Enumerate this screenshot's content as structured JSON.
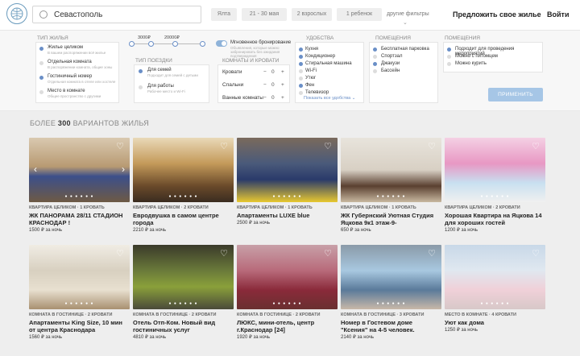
{
  "header": {
    "search_value": "Севастополь",
    "city": "Ялта",
    "dates": "21 - 30 мая",
    "guests": "2 взрослых",
    "children": "1 ребенок",
    "other_filters": "другие фильтры",
    "offer_link": "Предложить свое жилье",
    "login_link": "Войти"
  },
  "filters": {
    "housing_type": {
      "title": "ТИП ЖИЛЬЯ",
      "options": [
        {
          "label": "Жилье целиком",
          "sub": "В вашем распоряжении всё жилье"
        },
        {
          "label": "Отдельная комната",
          "sub": "В распоряжении комната, общие зоны"
        },
        {
          "label": "Гостиничный номер",
          "sub": "Отдельная комната в отеле или хостеле"
        },
        {
          "label": "Место в комнате",
          "sub": "Общее пространство с другими"
        }
      ]
    },
    "price": {
      "min": "3000₽",
      "max": "20000₽"
    },
    "trip_type": {
      "title": "ТИП ПОЕЗДКИ",
      "options": [
        {
          "label": "Для семей",
          "sub": "Подходит для семей с детьми"
        },
        {
          "label": "Для работы",
          "sub": "Рабочее место и Wi-Fi"
        }
      ]
    },
    "instant": {
      "label": "Мгновенное бронирование",
      "sub": "Объявления, которые можно забронировать без ожидания подтверждения"
    },
    "rooms": {
      "title": "КОМНАТЫ И КРОВАТИ",
      "rows": [
        {
          "label": "Кровати",
          "value": "0"
        },
        {
          "label": "Спальни",
          "value": "0"
        },
        {
          "label": "Ванные комнаты",
          "value": "0"
        }
      ]
    },
    "amenities": {
      "title": "УДОБСТВА",
      "options": [
        "Кухня",
        "Кондиционер",
        "Стиральная машина",
        "Wi-Fi",
        "Утюг",
        "Фен",
        "Телевизор"
      ],
      "show_all": "Показать все удобства"
    },
    "facilities": {
      "title": "ПОМЕЩЕНИЯ",
      "options": [
        "Бесплатная парковка",
        "Спортзал",
        "Джакузи",
        "Бассейн"
      ]
    },
    "rules": {
      "title": "ПОМЕЩЕНИЯ",
      "options": [
        "Подходит для проведения мероприятий",
        "Можно с питомцем",
        "Можно курить"
      ]
    },
    "apply": "ПРИМЕНИТЬ"
  },
  "results": {
    "count_prefix": "БОЛЕЕ ",
    "count": "300",
    "count_suffix": " ВАРИАНТОВ ЖИЛЬЯ",
    "listings": [
      {
        "type": "КВАРТИРА ЦЕЛИКОМ · 1 КРОВАТЬ",
        "title": "ЖК ПАНОРАМА 28/11 СТАДИОН КРАСНОДАР !",
        "price": "1500 ₽ за ночь"
      },
      {
        "type": "КВАРТИРА ЦЕЛИКОМ · 2 КРОВАТИ",
        "title": "Евродвушка в самом центре города",
        "price": "2210 ₽ за ночь"
      },
      {
        "type": "КВАРТИРА ЦЕЛИКОМ · 1 КРОВАТЬ",
        "title": "Апартаменты LUXE blue",
        "price": "2500 ₽ за ночь"
      },
      {
        "type": "КВАРТИРА ЦЕЛИКОМ · 1 КРОВАТЬ",
        "title": "ЖК Губернский Уютная Студия Яцкова 9к1 этаж-9-",
        "price": "650 ₽ за ночь"
      },
      {
        "type": "КВАРТИРА ЦЕЛИКОМ · 2 КРОВАТИ",
        "title": "Хорошая Квартира на Яцкова 14 для хороших гостей",
        "price": "1200 ₽ за ночь"
      },
      {
        "type": "КОМНАТА В ГОСТИНИЦЕ · 2 КРОВАТИ",
        "title": "Апартаменты King Size, 10 мин от центра Краснодара",
        "price": "1560 ₽ за ночь"
      },
      {
        "type": "КОМНАТА В ГОСТИНИЦЕ · 2 КРОВАТИ",
        "title": "Отель Отп-Ком. Новый вид гостиничных услуг",
        "price": "4810 ₽ за ночь"
      },
      {
        "type": "КОМНАТА В ГОСТИНИЦЕ · 2 КРОВАТИ",
        "title": "ЛЮКС, мини-отель, центр г.Краснодар [24]",
        "price": "1920 ₽ за ночь"
      },
      {
        "type": "КОМНАТА В ГОСТИНИЦЕ · 3 КРОВАТИ",
        "title": "Номер в Гостевом доме \"Ксения\" на 4-5 человек.",
        "price": "2140 ₽ за ночь"
      },
      {
        "type": "МЕСТО В КОМНАТЕ · 4 КРОВАТИ",
        "title": "Уют как дома",
        "price": "1250 ₽ за ночь"
      }
    ]
  },
  "colors": {
    "accent": "#6a8fc7",
    "apply": "#a6c6e6",
    "heart": "#ffffff"
  }
}
